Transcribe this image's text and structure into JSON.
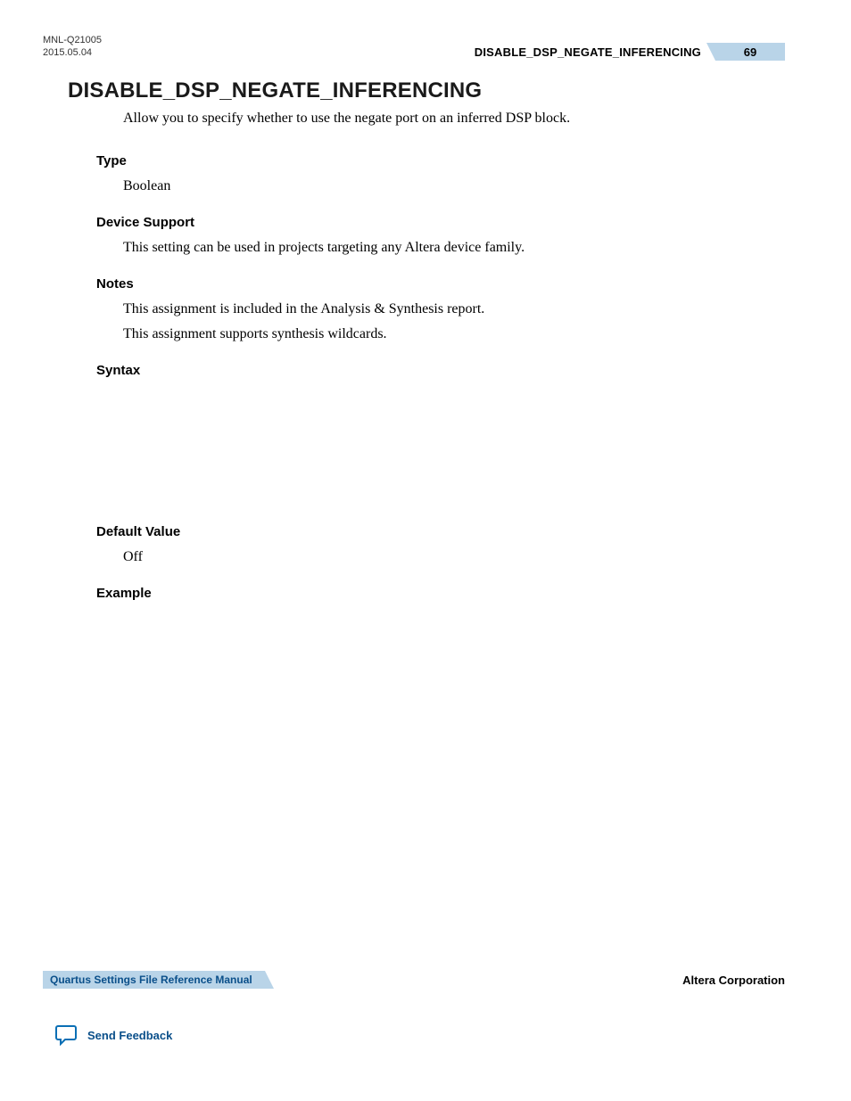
{
  "header": {
    "doc_id": "MNL-Q21005",
    "date": "2015.05.04",
    "title": "DISABLE_DSP_NEGATE_INFERENCING",
    "page": "69"
  },
  "main": {
    "title": "DISABLE_DSP_NEGATE_INFERENCING",
    "intro": "Allow you to specify whether to use the negate port on an inferred DSP block.",
    "sections": {
      "type": {
        "head": "Type",
        "body": "Boolean"
      },
      "device_support": {
        "head": "Device Support",
        "body": "This setting can be used in projects targeting any Altera device family."
      },
      "notes": {
        "head": "Notes",
        "line1": "This assignment is included in the Analysis & Synthesis report.",
        "line2": "This assignment supports synthesis wildcards."
      },
      "syntax": {
        "head": "Syntax"
      },
      "default_value": {
        "head": "Default Value",
        "body": "Off"
      },
      "example": {
        "head": "Example"
      }
    }
  },
  "footer": {
    "manual": "Quartus Settings File Reference Manual",
    "company": "Altera Corporation",
    "feedback": "Send Feedback"
  }
}
